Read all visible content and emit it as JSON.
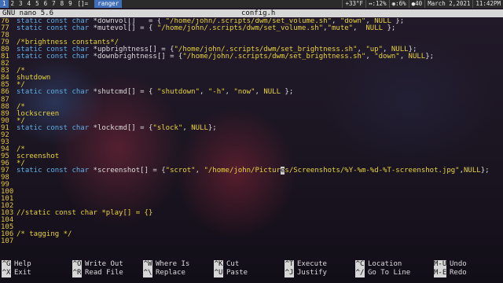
{
  "topbar": {
    "workspaces": [
      "1",
      "2",
      "3",
      "4",
      "5",
      "6",
      "7",
      "8",
      "9"
    ],
    "active_workspace": "1",
    "layout": "[]=",
    "window_title": "ranger",
    "status": [
      "+33°F",
      "↔:12%",
      "◉:6%",
      "●40",
      "March 2,2021",
      "11:42PM"
    ]
  },
  "nano": {
    "app": "GNU nano 5.6",
    "filename": "config.h"
  },
  "lines": [
    {
      "n": "76",
      "segs": [
        {
          "t": "static const char",
          "c": "kw"
        },
        {
          "t": " *downvol[]   = { "
        },
        {
          "t": "\"/home/john/.scripts/dwm/set_volume.sh\"",
          "c": "str"
        },
        {
          "t": ", "
        },
        {
          "t": "\"down\"",
          "c": "str"
        },
        {
          "t": ", "
        },
        {
          "t": "NULL",
          "c": "null"
        },
        {
          "t": " };"
        }
      ]
    },
    {
      "n": "77",
      "segs": [
        {
          "t": "static const char",
          "c": "kw"
        },
        {
          "t": " *mutevol[] = { "
        },
        {
          "t": "\"/home/john/.scripts/dwm/set_volume.sh\"",
          "c": "str"
        },
        {
          "t": ","
        },
        {
          "t": "\"mute\"",
          "c": "str"
        },
        {
          "t": ",  "
        },
        {
          "t": "NULL",
          "c": "null"
        },
        {
          "t": " };"
        }
      ]
    },
    {
      "n": "78",
      "segs": []
    },
    {
      "n": "79",
      "segs": [
        {
          "t": "/*brightness constants*/",
          "c": "cm"
        }
      ]
    },
    {
      "n": "80",
      "segs": [
        {
          "t": "static const char",
          "c": "kw"
        },
        {
          "t": " *upbrightness[] = {"
        },
        {
          "t": "\"/home/john/.scripts/dwm/set_brightness.sh\"",
          "c": "str"
        },
        {
          "t": ", "
        },
        {
          "t": "\"up\"",
          "c": "str"
        },
        {
          "t": ", "
        },
        {
          "t": "NULL",
          "c": "null"
        },
        {
          "t": "};"
        }
      ]
    },
    {
      "n": "81",
      "segs": [
        {
          "t": "static const char",
          "c": "kw"
        },
        {
          "t": " *downbrightness[] = {"
        },
        {
          "t": "\"/home/john/.scripts/dwm/set_brightness.sh\"",
          "c": "str"
        },
        {
          "t": ", "
        },
        {
          "t": "\"down\"",
          "c": "str"
        },
        {
          "t": ", "
        },
        {
          "t": "NULL",
          "c": "null"
        },
        {
          "t": "};"
        }
      ]
    },
    {
      "n": "82",
      "segs": []
    },
    {
      "n": "83",
      "segs": [
        {
          "t": "/*",
          "c": "cm"
        }
      ]
    },
    {
      "n": "84",
      "segs": [
        {
          "t": "shutdown",
          "c": "cm"
        }
      ]
    },
    {
      "n": "85",
      "segs": [
        {
          "t": "*/",
          "c": "cm"
        }
      ]
    },
    {
      "n": "86",
      "segs": [
        {
          "t": "static const char",
          "c": "kw"
        },
        {
          "t": " *shutcmd[] = { "
        },
        {
          "t": "\"shutdown\"",
          "c": "str"
        },
        {
          "t": ", "
        },
        {
          "t": "\"-h\"",
          "c": "str"
        },
        {
          "t": ", "
        },
        {
          "t": "\"now\"",
          "c": "str"
        },
        {
          "t": ", "
        },
        {
          "t": "NULL",
          "c": "null"
        },
        {
          "t": " };"
        }
      ]
    },
    {
      "n": "87",
      "segs": []
    },
    {
      "n": "88",
      "segs": [
        {
          "t": "/*",
          "c": "cm"
        }
      ]
    },
    {
      "n": "89",
      "segs": [
        {
          "t": "lockscreen",
          "c": "cm"
        }
      ]
    },
    {
      "n": "90",
      "segs": [
        {
          "t": "*/",
          "c": "cm"
        }
      ]
    },
    {
      "n": "91",
      "segs": [
        {
          "t": "static const char",
          "c": "kw"
        },
        {
          "t": " *lockcmd[] = {"
        },
        {
          "t": "\"slock\"",
          "c": "str"
        },
        {
          "t": ", "
        },
        {
          "t": "NULL",
          "c": "null"
        },
        {
          "t": "};"
        }
      ]
    },
    {
      "n": "92",
      "segs": []
    },
    {
      "n": "93",
      "segs": []
    },
    {
      "n": "94",
      "segs": [
        {
          "t": "/*",
          "c": "cm"
        }
      ]
    },
    {
      "n": "95",
      "segs": [
        {
          "t": "screenshot",
          "c": "cm"
        }
      ]
    },
    {
      "n": "96",
      "segs": [
        {
          "t": "*/",
          "c": "cm"
        }
      ]
    },
    {
      "n": "97",
      "segs": [
        {
          "t": "static const char",
          "c": "kw"
        },
        {
          "t": " *screenshot[] = {"
        },
        {
          "t": "\"scrot\"",
          "c": "str"
        },
        {
          "t": ", "
        },
        {
          "t": "\"/home/john/Pictur",
          "c": "str"
        },
        {
          "t": "e",
          "c": "cursor"
        },
        {
          "t": "s/Screenshots/%Y-%m-%d-%T-screenshot.jpg\"",
          "c": "str"
        },
        {
          "t": ","
        },
        {
          "t": "NULL",
          "c": "null"
        },
        {
          "t": "};"
        }
      ]
    },
    {
      "n": "98",
      "segs": []
    },
    {
      "n": "99",
      "segs": []
    },
    {
      "n": "100",
      "segs": []
    },
    {
      "n": "101",
      "segs": []
    },
    {
      "n": "102",
      "segs": []
    },
    {
      "n": "103",
      "segs": [
        {
          "t": "//static const char *play[] = {}",
          "c": "cm"
        }
      ]
    },
    {
      "n": "104",
      "segs": []
    },
    {
      "n": "105",
      "segs": []
    },
    {
      "n": "106",
      "segs": [
        {
          "t": "/* tagging */",
          "c": "cm"
        }
      ]
    },
    {
      "n": "107",
      "segs": []
    }
  ],
  "help": [
    {
      "key": "^G",
      "label": "Help"
    },
    {
      "key": "^X",
      "label": "Exit"
    },
    {
      "key": "^O",
      "label": "Write Out"
    },
    {
      "key": "^R",
      "label": "Read File"
    },
    {
      "key": "^W",
      "label": "Where Is"
    },
    {
      "key": "^\\",
      "label": "Replace"
    },
    {
      "key": "^K",
      "label": "Cut"
    },
    {
      "key": "^U",
      "label": "Paste"
    },
    {
      "key": "^T",
      "label": "Execute"
    },
    {
      "key": "^J",
      "label": "Justify"
    },
    {
      "key": "^C",
      "label": "Location"
    },
    {
      "key": "^/",
      "label": "Go To Line"
    },
    {
      "key": "M-U",
      "label": "Undo"
    },
    {
      "key": "M-E",
      "label": "Redo"
    }
  ]
}
